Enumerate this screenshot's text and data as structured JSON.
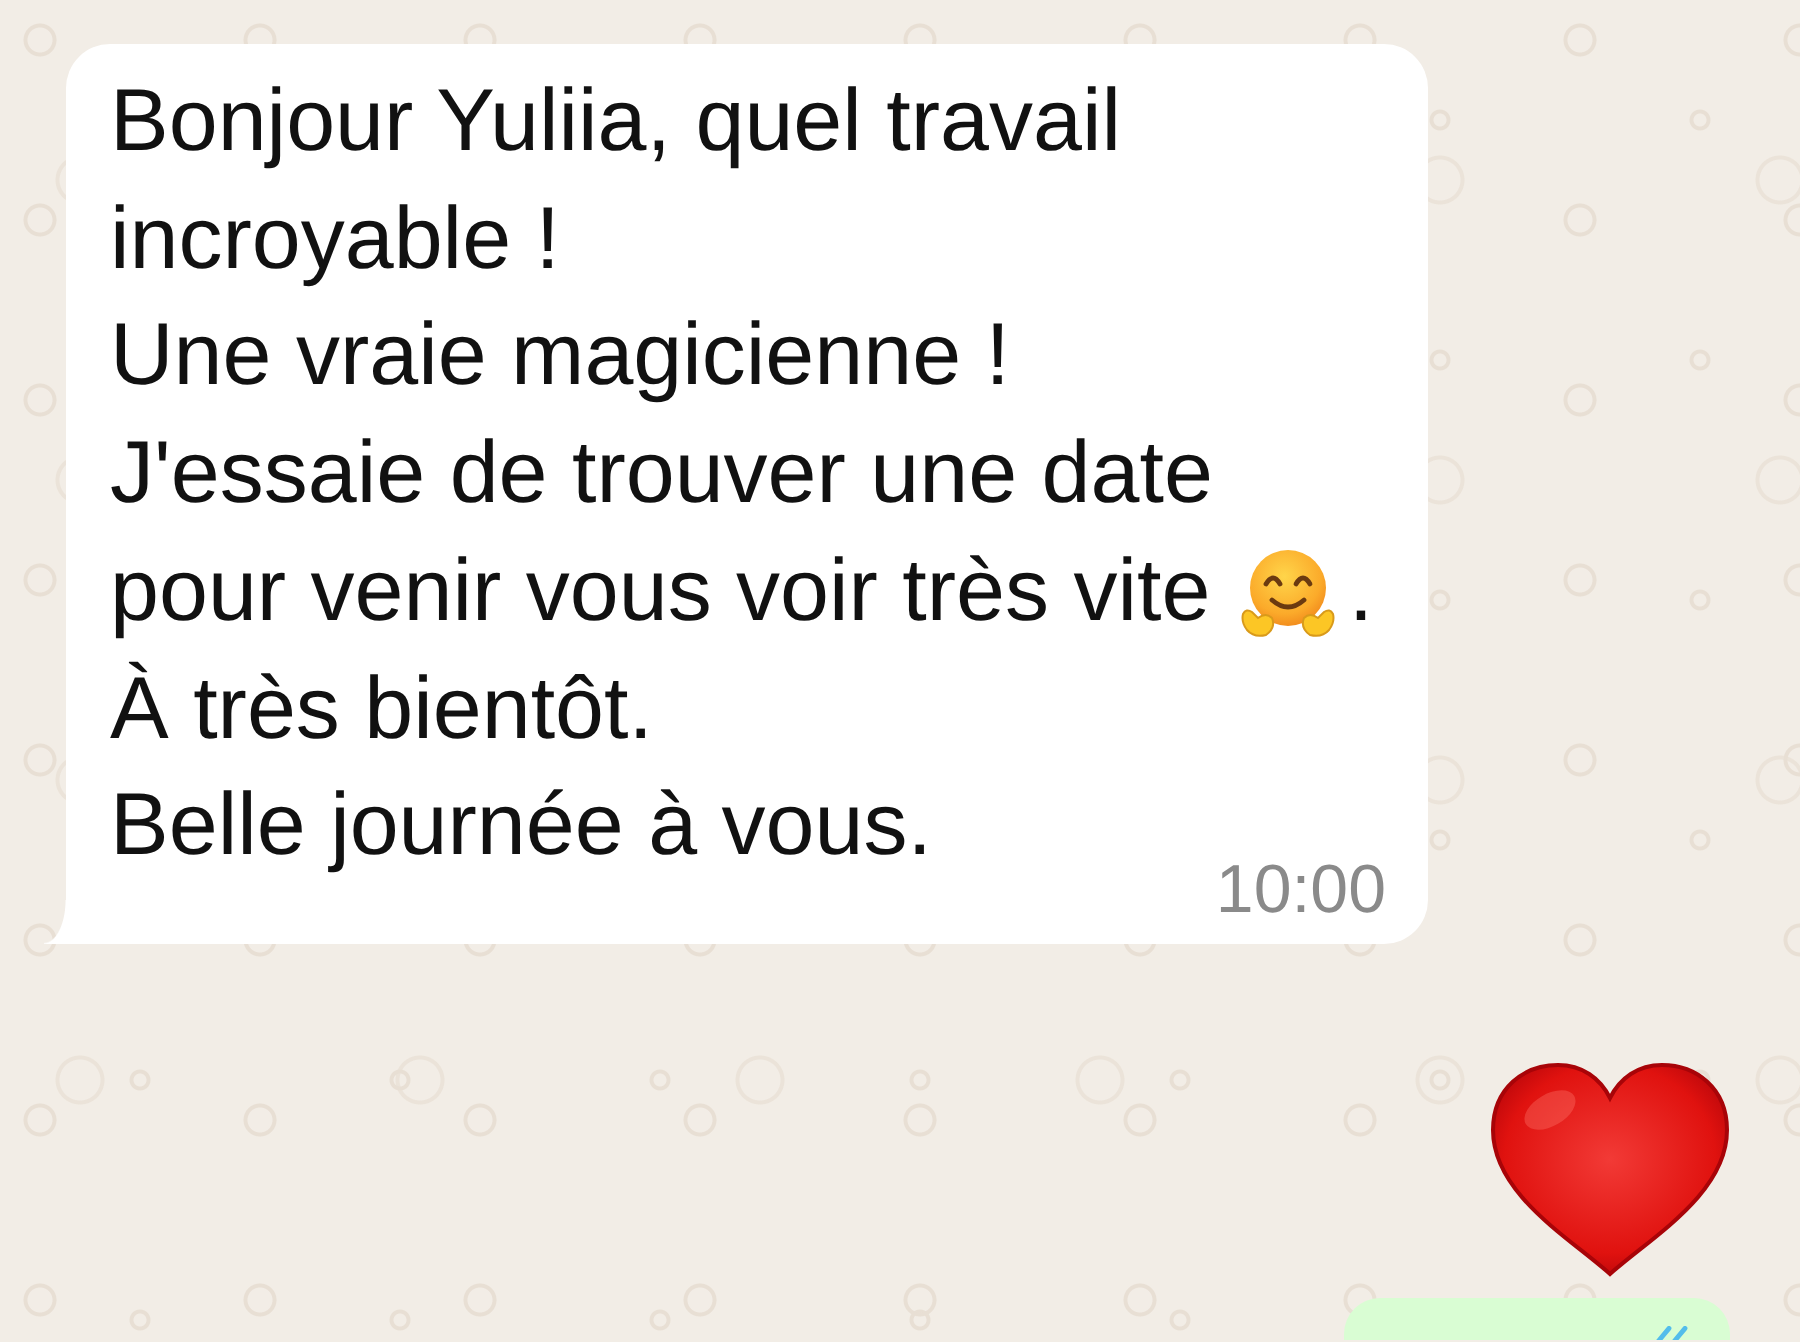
{
  "chat": {
    "messages": [
      {
        "kind": "text",
        "outgoing": false,
        "paragraphs": [
          {
            "lines": [
              "Bonjour Yuliia, quel travail",
              "incroyable !"
            ]
          },
          {
            "lines": [
              "Une vraie magicienne !"
            ]
          },
          {
            "lines": [
              "J'essaie de trouver une date",
              "pour venir vous voir très vite"
            ],
            "emoji": true,
            "after_emoji": "."
          },
          {
            "lines": [
              "À très bientôt."
            ]
          },
          {
            "lines": [
              "Belle journée à vous."
            ]
          }
        ],
        "time": "10:00"
      },
      {
        "kind": "emoji",
        "outgoing": true
      },
      {
        "kind": "text",
        "outgoing": true,
        "read": true
      }
    ]
  }
}
